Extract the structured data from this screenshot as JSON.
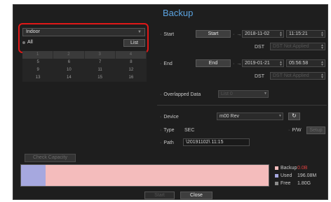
{
  "title": "Backup",
  "camera": {
    "selected": "Indoor",
    "all_label": "All",
    "list_label": "List",
    "grid_header": [
      "1",
      "2",
      "3",
      "4"
    ],
    "grid_rows": [
      [
        "5",
        "6",
        "7",
        "8"
      ],
      [
        "9",
        "10",
        "11",
        "12"
      ],
      [
        "13",
        "14",
        "15",
        "16"
      ]
    ]
  },
  "start": {
    "label": "Start",
    "button": "Start",
    "separator": "→",
    "date": "2018-11-02",
    "time": "11:15:21",
    "dst_label": "DST",
    "dst_value": "DST Not Applied"
  },
  "end": {
    "label": "End",
    "button": "End",
    "separator": "→",
    "date": "2019-01-21",
    "time": "05:56:58",
    "dst_label": "DST",
    "dst_value": "DST Not Applied"
  },
  "overlapped": {
    "label": "Overlapped Data",
    "value": "List 0"
  },
  "device": {
    "label": "Device",
    "value": "m00 Rev",
    "refresh_icon": "refresh-icon"
  },
  "type": {
    "label": "Type",
    "value": "SEC",
    "pw_label": "P/W",
    "setup_label": "Setup"
  },
  "path": {
    "label": "Path",
    "value": "\\20191102\\  11:15"
  },
  "capacity": {
    "check_label": "Check Capacity",
    "used_fraction": 0.1,
    "legend": [
      {
        "key": "Backup",
        "value": "0.0B",
        "color": "#f4bcbc",
        "value_color": "#e04040"
      },
      {
        "key": "Used",
        "value": "196.08M",
        "color": "#a6a8df",
        "value_color": "#c8c8c8"
      },
      {
        "key": "Free",
        "value": "1.80G",
        "color": "#8a8a8a",
        "value_color": "#c8c8c8"
      }
    ]
  },
  "footer": {
    "start_label": "Start",
    "close_label": "Close"
  }
}
